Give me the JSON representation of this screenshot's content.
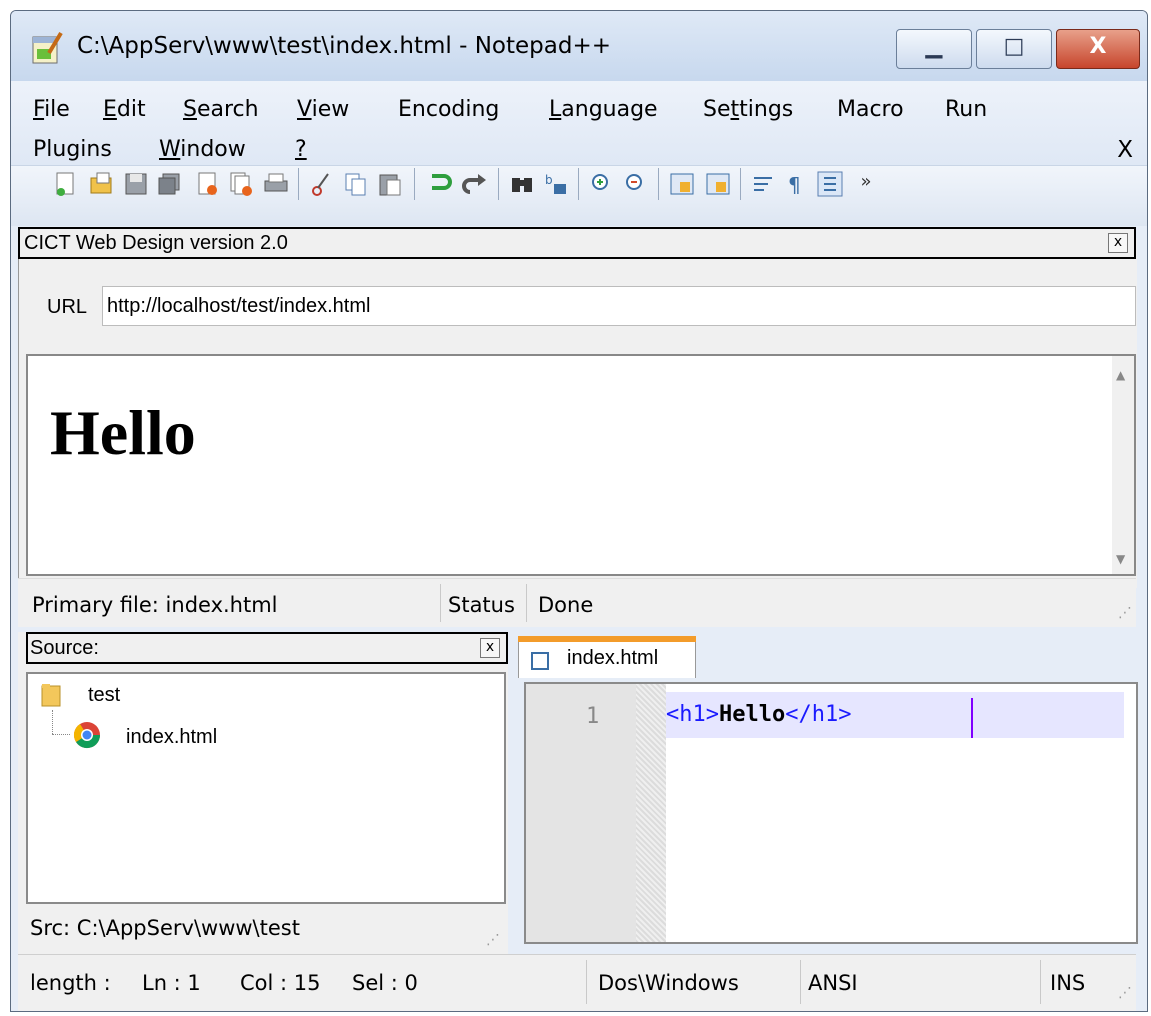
{
  "window": {
    "title": "C:\\AppServ\\www\\test\\index.html - Notepad++",
    "min_glyph": "▁",
    "max_glyph": "□",
    "close_glyph": "X"
  },
  "menu": {
    "items": [
      {
        "label": "File",
        "underline": "F"
      },
      {
        "label": "Edit",
        "underline": "E"
      },
      {
        "label": "Search",
        "underline": "S"
      },
      {
        "label": "View",
        "underline": "V"
      },
      {
        "label": "Encoding",
        "underline": ""
      },
      {
        "label": "Language",
        "underline": "L"
      },
      {
        "label": "Settings",
        "underline": "t"
      },
      {
        "label": "Macro",
        "underline": ""
      },
      {
        "label": "Run",
        "underline": ""
      },
      {
        "label": "Plugins",
        "underline": ""
      },
      {
        "label": "Window",
        "underline": "W"
      },
      {
        "label": "?",
        "underline": "?"
      }
    ],
    "close": "X"
  },
  "toolbar": {
    "overflow": "»"
  },
  "plugin_panel": {
    "title": "CICT Web Design version 2.0",
    "close": "x",
    "url_label": "URL",
    "url_value": "http://localhost/test/index.html",
    "preview_heading": "Hello",
    "status_primary": "Primary file: index.html",
    "status_label": "Status",
    "status_value": "Done"
  },
  "source_panel": {
    "title": "Source:",
    "close": "x",
    "tree_root": "test",
    "tree_child": "index.html",
    "path": "Src: C:\\AppServ\\www\\test"
  },
  "editor": {
    "tab_label": "index.html",
    "line_number": "1",
    "code_open": "<h1>",
    "code_text": "Hello",
    "code_close": "</h1>"
  },
  "statusbar": {
    "length": "length :",
    "ln": "Ln : 1",
    "col": "Col : 15",
    "sel": "Sel : 0",
    "eol": "Dos\\Windows",
    "encoding": "ANSI",
    "mode": "INS"
  }
}
